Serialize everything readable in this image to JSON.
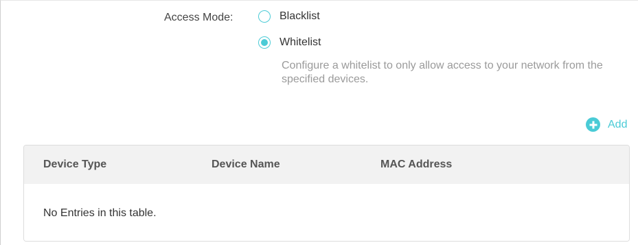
{
  "access_mode": {
    "label": "Access Mode:",
    "options": [
      {
        "label": "Blacklist",
        "selected": false
      },
      {
        "label": "Whitelist",
        "selected": true
      }
    ],
    "description": "Configure a whitelist to only allow access to your network from the specified devices."
  },
  "toolbar": {
    "add_label": "Add",
    "add_icon": "plus-circle-icon"
  },
  "table": {
    "columns": [
      "Device Type",
      "Device Name",
      "MAC Address"
    ],
    "rows": [],
    "empty_text": "No Entries in this table."
  },
  "colors": {
    "accent": "#4acbd6",
    "header_bg": "#f2f2f2",
    "muted_text": "#9a9a9a"
  }
}
